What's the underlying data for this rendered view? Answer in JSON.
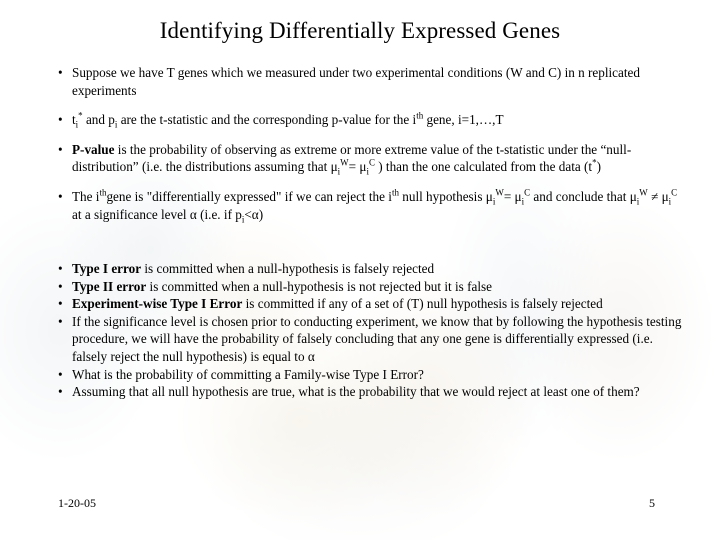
{
  "slide": {
    "title": "Identifying Differentially Expressed Genes",
    "bullet_glyph": "•",
    "background_note": "faint washed-out photographic image",
    "colors": {
      "text": "#000000",
      "background": "#ffffff"
    }
  },
  "body": {
    "group_spaced": [
      {
        "id": "b1",
        "segments": [
          {
            "text": "Suppose we have T genes which we measured under two experimental conditions (W and C) in n replicated experiments"
          }
        ]
      },
      {
        "id": "b2",
        "segments": [
          {
            "text": "t"
          },
          {
            "text": "i",
            "style": "sub"
          },
          {
            "text": "*",
            "style": "sup"
          },
          {
            "text": " and p"
          },
          {
            "text": "i",
            "style": "sub"
          },
          {
            "text": " are the t-statistic and the corresponding p-value for the i"
          },
          {
            "text": "th",
            "style": "sup"
          },
          {
            "text": " gene, i=1,…,T"
          }
        ]
      },
      {
        "id": "b3",
        "segments": [
          {
            "text": "P-value",
            "style": "bold"
          },
          {
            "text": " is the probability of observing as extreme or more extreme value of the t-statistic under the “null-distribution” (i.e. the distributions assuming that μ"
          },
          {
            "text": "i",
            "style": "sub"
          },
          {
            "text": "W",
            "style": "sup"
          },
          {
            "text": "= μ"
          },
          {
            "text": "i",
            "style": "sub"
          },
          {
            "text": "C",
            "style": "sup"
          },
          {
            "text": " ) than the one calculated from the data (t"
          },
          {
            "text": "*",
            "style": "sup"
          },
          {
            "text": ")"
          }
        ]
      },
      {
        "id": "b4",
        "segments": [
          {
            "text": "The i"
          },
          {
            "text": "th",
            "style": "sup"
          },
          {
            "text": "gene is \"differentially expressed\" if we can reject the i"
          },
          {
            "text": "th",
            "style": "sup"
          },
          {
            "text": " null hypothesis μ"
          },
          {
            "text": "i",
            "style": "sub"
          },
          {
            "text": "W",
            "style": "sup"
          },
          {
            "text": "= μ"
          },
          {
            "text": "i",
            "style": "sub"
          },
          {
            "text": "C",
            "style": "sup"
          },
          {
            "text": " and conclude that μ"
          },
          {
            "text": "i",
            "style": "sub"
          },
          {
            "text": "W",
            "style": "sup"
          },
          {
            "text": " ≠ μ"
          },
          {
            "text": "i",
            "style": "sub"
          },
          {
            "text": "C",
            "style": "sup"
          },
          {
            "text": " at a significance level α (i.e. if p"
          },
          {
            "text": "i",
            "style": "sub"
          },
          {
            "text": "<α)"
          }
        ]
      }
    ],
    "group_tight": [
      {
        "id": "b5",
        "segments": [
          {
            "text": "Type I error",
            "style": "bold"
          },
          {
            "text": " is committed when a null-hypothesis is falsely rejected"
          }
        ]
      },
      {
        "id": "b6",
        "segments": [
          {
            "text": "Type II error",
            "style": "bold"
          },
          {
            "text": " is committed when a null-hypothesis is not rejected but it is false"
          }
        ]
      },
      {
        "id": "b7",
        "segments": [
          {
            "text": "Experiment-wise Type I Error",
            "style": "bold"
          },
          {
            "text": " is committed if any of a set of (T) null hypothesis is falsely rejected"
          }
        ]
      },
      {
        "id": "b8",
        "segments": [
          {
            "text": "If the significance level is chosen prior to conducting experiment, we know that by following the hypothesis testing procedure, we will have the probability of falsely concluding that any one gene is differentially expressed (i.e. falsely reject the null hypothesis) is equal to α"
          }
        ]
      },
      {
        "id": "b9",
        "segments": [
          {
            "text": "What is the probability of committing a Family-wise Type I Error?"
          }
        ]
      },
      {
        "id": "b10",
        "segments": [
          {
            "text": "Assuming that all null hypothesis are true, what is the probability that we would reject at least one of them?"
          }
        ]
      }
    ]
  },
  "footer": {
    "date": "1-20-05",
    "page_number": "5"
  }
}
